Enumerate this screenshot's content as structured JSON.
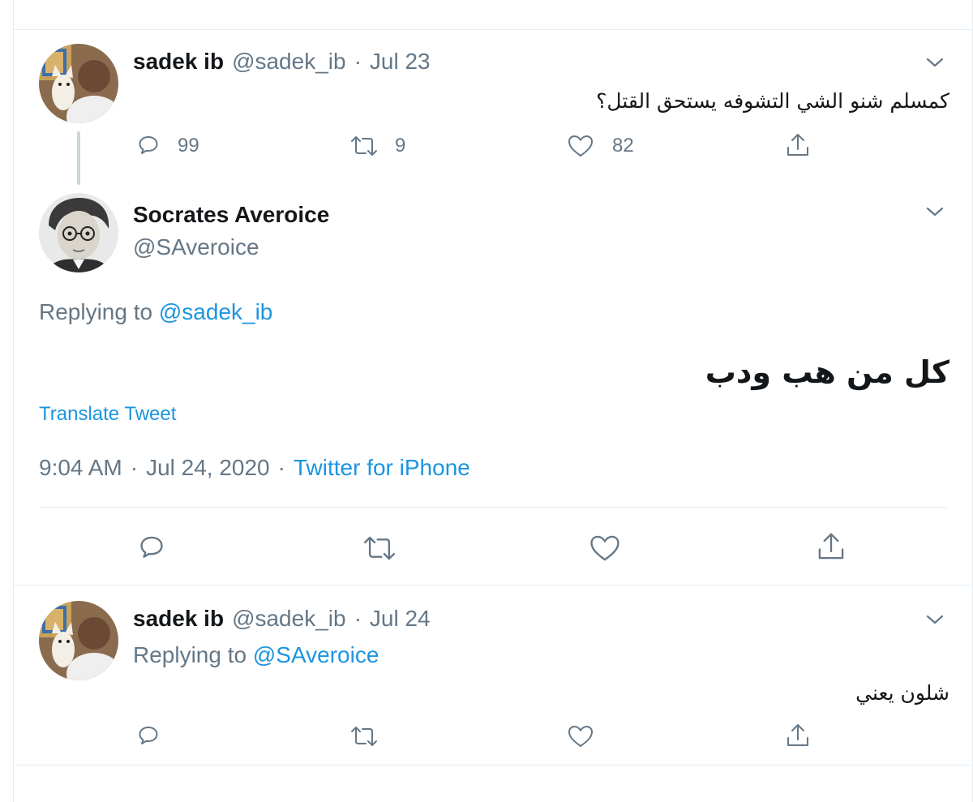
{
  "colors": {
    "text": "#14171a",
    "secondary": "#657786",
    "link": "#1b95e0",
    "divider": "#e6ecf0",
    "thread_line": "#ccd6dd"
  },
  "tweet1": {
    "name": "sadek ib",
    "handle": "@sadek_ib",
    "separator": "·",
    "date": "Jul 23",
    "text": "كمسلم شنو الشي التشوفه يستحق القتل؟",
    "replies": "99",
    "retweets": "9",
    "likes": "82"
  },
  "main_tweet": {
    "name": "Socrates Averoice",
    "handle": "@SAveroice",
    "replying_label": "Replying to",
    "replying_to": "@sadek_ib",
    "text": "كل من هب ودب",
    "translate_label": "Translate Tweet",
    "time": "9:04 AM",
    "separator": "·",
    "date": "Jul 24, 2020",
    "separator2": "·",
    "source": "Twitter for iPhone"
  },
  "tweet3": {
    "name": "sadek ib",
    "handle": "@sadek_ib",
    "separator": "·",
    "date": "Jul 24",
    "replying_label": "Replying to",
    "replying_to": "@SAveroice",
    "text": "شلون يعني"
  },
  "icons": {
    "reply": "reply-icon",
    "retweet": "retweet-icon",
    "like": "heart-icon",
    "share": "share-icon",
    "more": "chevron-down-icon"
  }
}
